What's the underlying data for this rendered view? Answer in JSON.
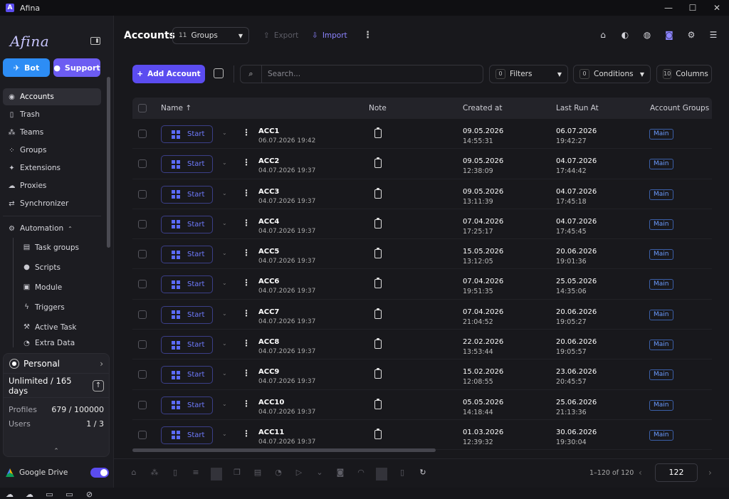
{
  "window": {
    "title": "Afina",
    "controls": [
      "—",
      "☐",
      "✕"
    ]
  },
  "sidebar": {
    "logo": "Afina",
    "bot_label": "Bot",
    "support_label": "Support",
    "items": [
      {
        "label": "Accounts",
        "icon": "user-circle-icon"
      },
      {
        "label": "Trash",
        "icon": "trash-icon"
      },
      {
        "label": "Teams",
        "icon": "team-icon"
      },
      {
        "label": "Groups",
        "icon": "groups-icon"
      },
      {
        "label": "Extensions",
        "icon": "puzzle-icon"
      },
      {
        "label": "Proxies",
        "icon": "cloud-icon"
      },
      {
        "label": "Synchronizer",
        "icon": "sync-icon"
      }
    ],
    "automation_label": "Automation",
    "automation_items": [
      {
        "label": "Task groups"
      },
      {
        "label": "Scripts"
      },
      {
        "label": "Module"
      },
      {
        "label": "Triggers"
      },
      {
        "label": "Active Task"
      },
      {
        "label": "Extra Data"
      }
    ],
    "plan": {
      "name": "Personal",
      "limit": "Unlimited / 165 days",
      "profiles_label": "Profiles",
      "profiles_value": "679 / 100000",
      "users_label": "Users",
      "users_value": "1 / 3"
    },
    "gdrive_label": "Google Drive"
  },
  "header": {
    "title": "Accounts",
    "groups_count": "11",
    "groups_label": "Groups",
    "export_label": "Export",
    "import_label": "Import"
  },
  "toolbar": {
    "add_label": "Add Account",
    "search_placeholder": "Search...",
    "filters_count": "0",
    "filters_label": "Filters",
    "conditions_count": "0",
    "conditions_label": "Conditions",
    "columns_count": "10",
    "columns_label": "Columns"
  },
  "table": {
    "columns": {
      "name": "Name ↑",
      "note": "Note",
      "created": "Created at",
      "last_run": "Last Run At",
      "groups": "Account Groups"
    },
    "start_label": "Start",
    "rows": [
      {
        "name": "ACC1",
        "sub": "06.07.2026 19:42",
        "created_date": "09.05.2026",
        "created_time": "14:55:31",
        "run_date": "06.07.2026",
        "run_time": "19:42:27",
        "group": "Main"
      },
      {
        "name": "ACC2",
        "sub": "04.07.2026 19:37",
        "created_date": "09.05.2026",
        "created_time": "12:38:09",
        "run_date": "04.07.2026",
        "run_time": "17:44:42",
        "group": "Main"
      },
      {
        "name": "ACC3",
        "sub": "04.07.2026 19:37",
        "created_date": "09.05.2026",
        "created_time": "13:11:39",
        "run_date": "04.07.2026",
        "run_time": "17:45:18",
        "group": "Main"
      },
      {
        "name": "ACC4",
        "sub": "04.07.2026 19:37",
        "created_date": "07.04.2026",
        "created_time": "17:25:17",
        "run_date": "04.07.2026",
        "run_time": "17:45:45",
        "group": "Main"
      },
      {
        "name": "ACC5",
        "sub": "04.07.2026 19:37",
        "created_date": "15.05.2026",
        "created_time": "13:12:05",
        "run_date": "20.06.2026",
        "run_time": "19:01:36",
        "group": "Main"
      },
      {
        "name": "ACC6",
        "sub": "04.07.2026 19:37",
        "created_date": "07.04.2026",
        "created_time": "19:51:35",
        "run_date": "25.05.2026",
        "run_time": "14:35:06",
        "group": "Main"
      },
      {
        "name": "ACC7",
        "sub": "04.07.2026 19:37",
        "created_date": "07.04.2026",
        "created_time": "21:04:52",
        "run_date": "20.06.2026",
        "run_time": "19:05:27",
        "group": "Main"
      },
      {
        "name": "ACC8",
        "sub": "04.07.2026 19:37",
        "created_date": "22.02.2026",
        "created_time": "13:53:44",
        "run_date": "20.06.2026",
        "run_time": "19:05:57",
        "group": "Main"
      },
      {
        "name": "ACC9",
        "sub": "04.07.2026 19:37",
        "created_date": "15.02.2026",
        "created_time": "12:08:55",
        "run_date": "23.06.2026",
        "run_time": "20:45:57",
        "group": "Main"
      },
      {
        "name": "ACC10",
        "sub": "04.07.2026 19:37",
        "created_date": "05.05.2026",
        "created_time": "14:18:44",
        "run_date": "25.06.2026",
        "run_time": "21:13:36",
        "group": "Main"
      },
      {
        "name": "ACC11",
        "sub": "04.07.2026 19:37",
        "created_date": "01.03.2026",
        "created_time": "12:39:32",
        "run_date": "30.06.2026",
        "run_time": "19:30:04",
        "group": "Main"
      }
    ]
  },
  "pager": {
    "range": "1–120 of 120",
    "page_size": "122"
  }
}
